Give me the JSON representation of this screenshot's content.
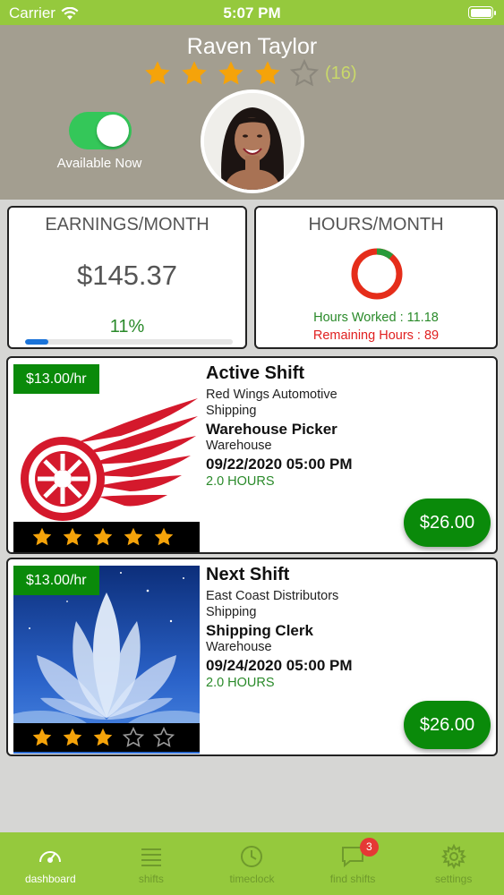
{
  "status_bar": {
    "carrier": "Carrier",
    "time": "5:07 PM"
  },
  "profile": {
    "name": "Raven Taylor",
    "rating": 4,
    "rating_max": 5,
    "rating_count": "(16)",
    "available_label": "Available Now",
    "available_on": true
  },
  "earnings": {
    "title": "EARNINGS/MONTH",
    "value": "$145.37",
    "percent": "11%",
    "progress": 0.11
  },
  "hours": {
    "title": "HOURS/MONTH",
    "worked": "Hours Worked : 11.18",
    "remaining": "Remaining Hours : 89",
    "worked_fraction": 0.11
  },
  "shifts": [
    {
      "rate": "$13.00/hr",
      "heading": "Active Shift",
      "company": "Red Wings Automotive",
      "department": "Shipping",
      "position": "Warehouse Picker",
      "location": "Warehouse",
      "datetime": "09/22/2020 05:00 PM",
      "duration": "2.0 HOURS",
      "pay": "$26.00",
      "stars": 5,
      "image": "red-wings-logo"
    },
    {
      "rate": "$13.00/hr",
      "heading": "Next Shift",
      "company": "East Coast Distributors",
      "department": "Shipping",
      "position": "Shipping Clerk",
      "location": "Warehouse",
      "datetime": "09/24/2020 05:00 PM",
      "duration": "2.0 HOURS",
      "pay": "$26.00",
      "stars": 3,
      "image": "lotus-flower"
    }
  ],
  "tabs": [
    {
      "label": "dashboard",
      "icon": "speedometer-icon",
      "active": true
    },
    {
      "label": "shifts",
      "icon": "list-icon",
      "active": false
    },
    {
      "label": "timeclock",
      "icon": "clock-icon",
      "active": false
    },
    {
      "label": "find shifts",
      "icon": "chat-bubble-icon",
      "active": false,
      "badge": "3"
    },
    {
      "label": "settings",
      "icon": "gear-icon",
      "active": false
    }
  ],
  "colors": {
    "accent": "#95c93d",
    "header": "#a39e90",
    "green": "#0a8a0a",
    "star": "#f5a30a"
  }
}
